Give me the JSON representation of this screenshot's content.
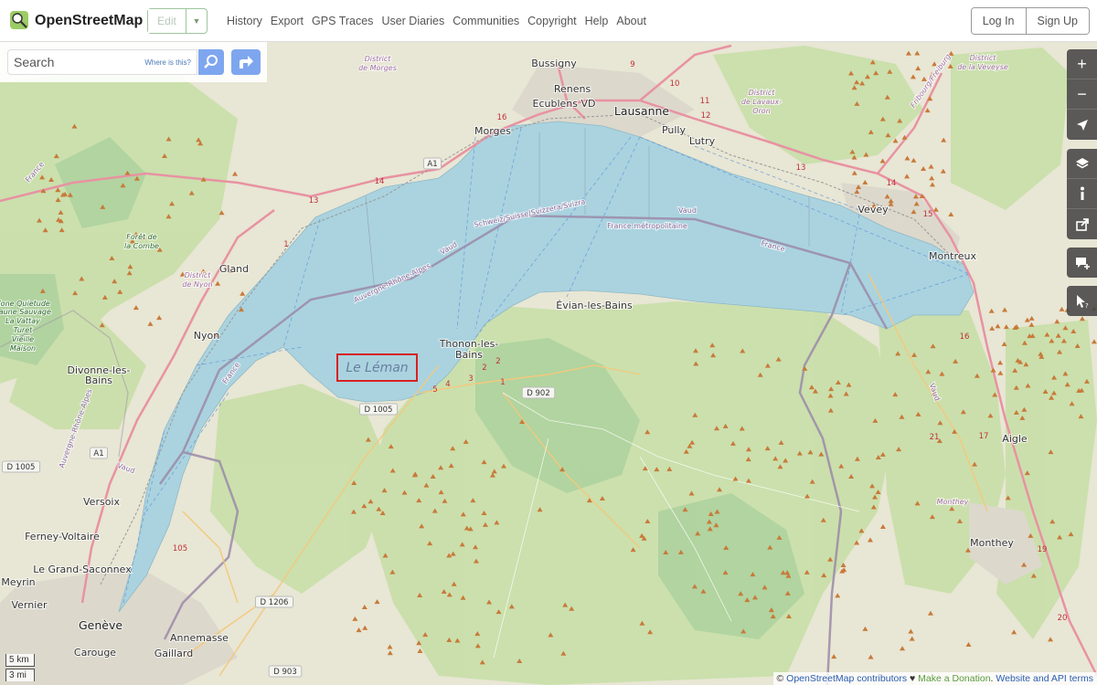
{
  "header": {
    "brand": "OpenStreetMap",
    "edit_label": "Edit",
    "nav": [
      "History",
      "Export",
      "GPS Traces",
      "User Diaries",
      "Communities",
      "Copyright",
      "Help",
      "About"
    ],
    "login": "Log In",
    "signup": "Sign Up"
  },
  "search": {
    "placeholder": "Search",
    "where_link": "Where is this?"
  },
  "controls": {
    "zoom_in": "+",
    "zoom_out": "−",
    "icons": [
      "zoom-in-icon",
      "zoom-out-icon",
      "locate-icon",
      "layers-icon",
      "info-icon",
      "share-icon",
      "note-icon",
      "query-icon"
    ]
  },
  "scale": {
    "km": "5 km",
    "mi": "3 mi"
  },
  "attribution": {
    "prefix": "©",
    "contributors": "OpenStreetMap contributors",
    "heart": "♥",
    "donation": "Make a Donation",
    "sep": ".",
    "api": "Website and API terms"
  },
  "map_labels": {
    "lake": "Le Léman",
    "cities": [
      "Lausanne",
      "Genève"
    ],
    "towns": [
      "Morges",
      "Nyon",
      "Évian-les-Bains",
      "Thonon-les-",
      "Bains",
      "Vevey",
      "Montreux",
      "Gland",
      "Versoix",
      "Divonne-les-",
      "Bains",
      "Annemasse",
      "Monthey",
      "Aigle",
      "Renens",
      "Pully",
      "Lutry",
      "Bussigny",
      "Ecublens VD",
      "Carouge",
      "Meyrin",
      "Vernier",
      "Ferney-Voltaire",
      "Le Grand-Saconnex",
      "Gaillard"
    ],
    "regions": [
      "District",
      "de Morges",
      "District",
      "de Nyon",
      "District",
      "de Lavaux-",
      "Oron",
      "District",
      "de la Veveyse",
      "Monthey",
      "Fribourg/Freiburg"
    ],
    "borders": [
      "Auvergne-Rhône-Alpes",
      "Vaud",
      "Schweiz/Suisse/Svizzera/Svizra",
      "France métropolitaine",
      "Vaud",
      "France",
      "France",
      "France",
      "Vaud",
      "Auvergne-Rhône-Alpes",
      "Vaud"
    ],
    "park": [
      "Forêt de",
      "la Combe",
      "Zone Quietude",
      "Faune Sauvage",
      "La Vattay",
      "Turet",
      "Vieille",
      "Maison"
    ],
    "shields": [
      "A1",
      "1",
      "14",
      "13",
      "16",
      "9",
      "10",
      "11",
      "12",
      "D 1005",
      "D 902",
      "D 1005",
      "105",
      "D 1206",
      "D 903",
      "21",
      "A1",
      "13",
      "14",
      "15",
      "16",
      "17",
      "19",
      "20",
      "5",
      "4",
      "3",
      "2",
      "2",
      "1"
    ]
  }
}
